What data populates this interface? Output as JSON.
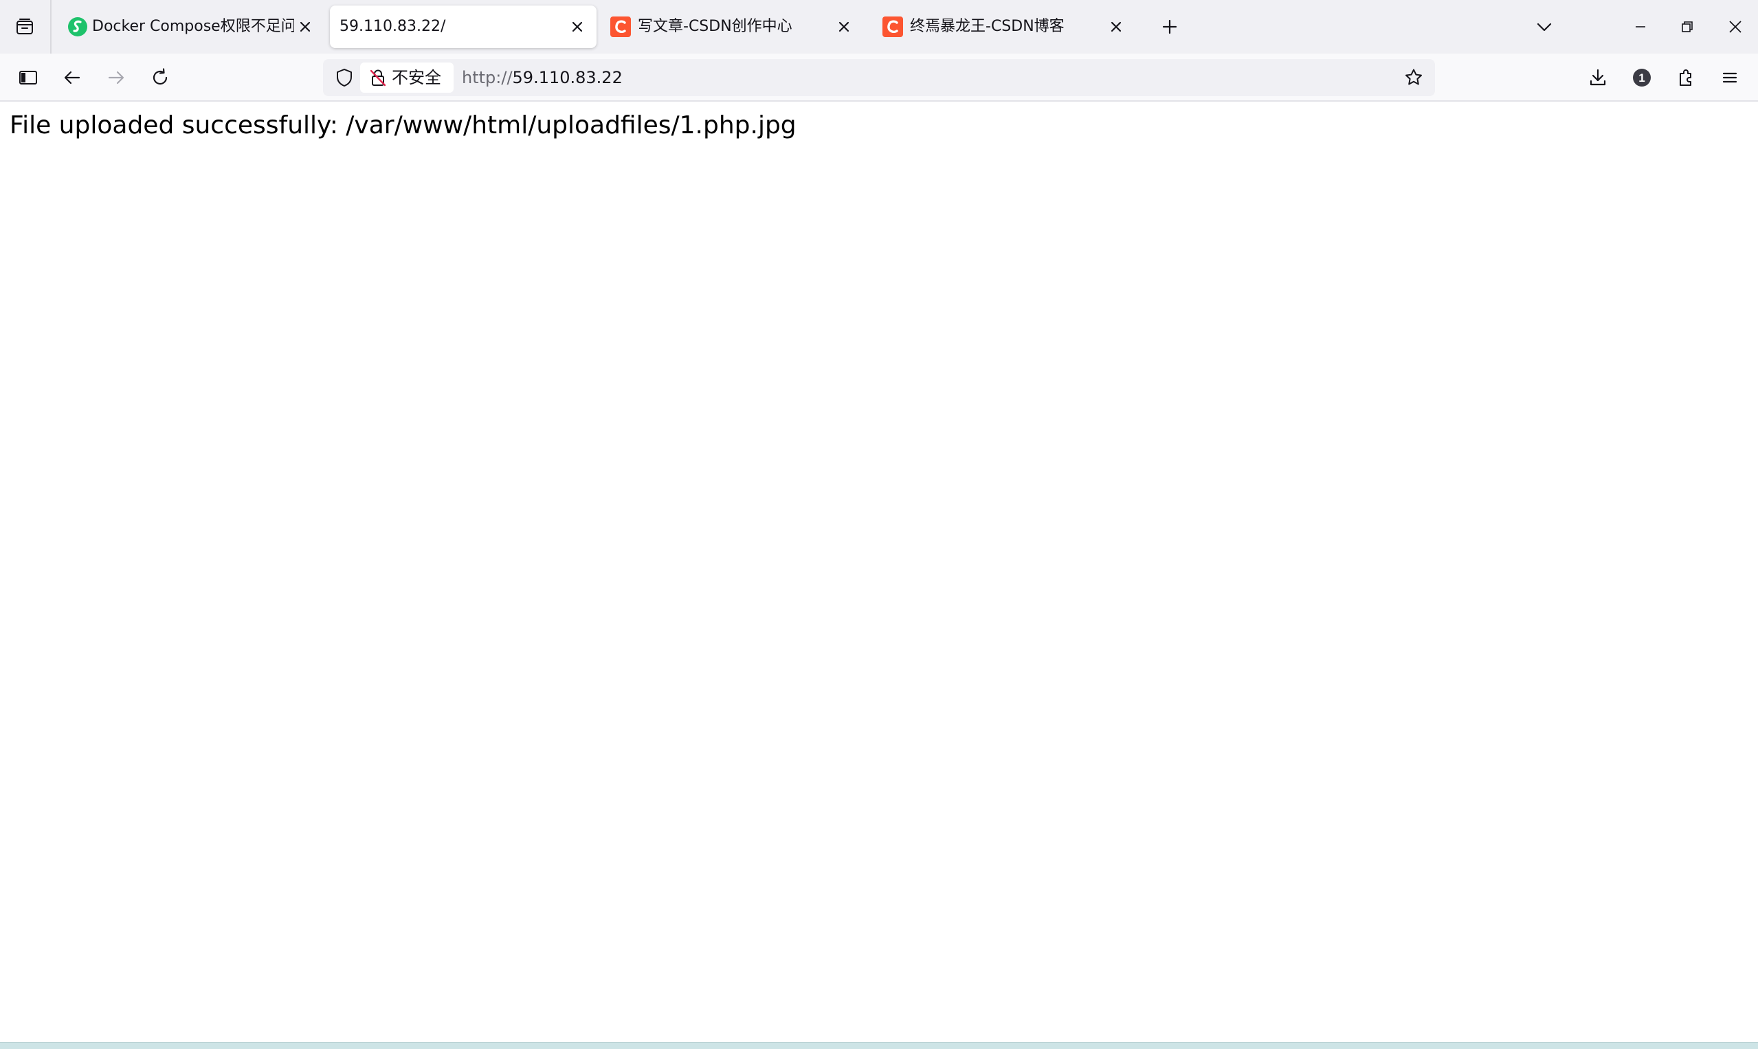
{
  "browser": {
    "tabs": [
      {
        "title": "Docker Compose权限不足问题",
        "favicon": "green-s-favicon",
        "active": false
      },
      {
        "title": "59.110.83.22/",
        "favicon": "none",
        "active": true
      },
      {
        "title": "写文章-CSDN创作中心",
        "favicon": "csdn-favicon",
        "active": false
      },
      {
        "title": "终焉暴龙王-CSDN博客",
        "favicon": "csdn-favicon",
        "active": false
      }
    ],
    "urlbar": {
      "insecure_label": "不安全",
      "scheme": "http://",
      "host": "59.110.83.22"
    },
    "extension_badge": "1"
  },
  "page": {
    "message": "File uploaded successfully: /var/www/html/uploadfiles/1.php.jpg"
  },
  "colors": {
    "tabstrip_bg": "#f0f0f4",
    "navbar_bg": "#f9f9fb",
    "csdn_red": "#fc5531",
    "favicon_green": "#1ec26b",
    "text": "#15141a"
  }
}
